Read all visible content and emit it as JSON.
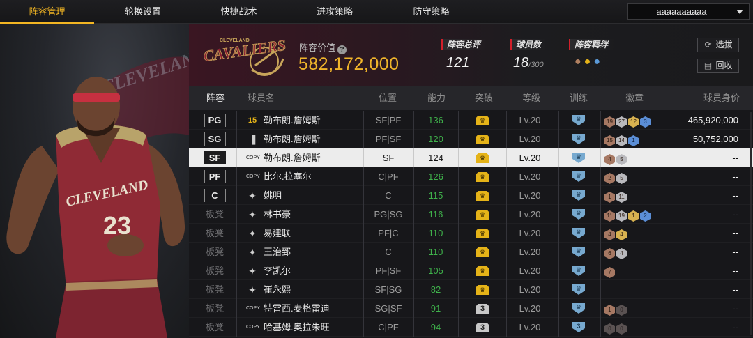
{
  "nav": {
    "tabs": [
      {
        "label": "阵容管理",
        "active": true
      },
      {
        "label": "轮换设置",
        "active": false
      },
      {
        "label": "快捷战术",
        "active": false
      },
      {
        "label": "进攻策略",
        "active": false
      },
      {
        "label": "防守策略",
        "active": false
      }
    ],
    "account_dropdown": "aaaaaaaaaa"
  },
  "team": {
    "logo_text": "CAVALIERS",
    "logo_subtext": "CLEVELAND",
    "value_label": "阵容价值",
    "value": "582,172,000",
    "stats": [
      {
        "label": "阵容总评",
        "value": "121"
      },
      {
        "label": "球员数",
        "value": "18",
        "suffix": "/300"
      },
      {
        "label": "阵容羁绊",
        "value": ""
      }
    ],
    "bond_icons": [
      "bond-icon-bronze",
      "bond-icon-gold",
      "bond-icon-blue"
    ],
    "buttons": {
      "select": "选拔",
      "recycle": "回收"
    }
  },
  "player_art": {
    "jersey_team": "CLEVELAND",
    "jersey_number": "23",
    "bg_text": "CLEVELAND CAVALIERS"
  },
  "table": {
    "headers": {
      "lineup": "阵容",
      "name": "球员名",
      "position": "位置",
      "ability": "能力",
      "breakthrough": "突破",
      "level": "等级",
      "training": "训练",
      "badges": "徽章",
      "value": "球员身价"
    },
    "rows": [
      {
        "slot": "PG",
        "starter": true,
        "card": "15",
        "name": "勒布朗.詹姆斯",
        "pos": "SF|PF",
        "ability": "136",
        "brk": "gold",
        "brk_text": "",
        "level": "Lv.20",
        "train": "",
        "badges": [
          {
            "t": "bronze",
            "v": "19"
          },
          {
            "t": "silver",
            "v": "27"
          },
          {
            "t": "gold",
            "v": "12"
          },
          {
            "t": "blue",
            "v": "3"
          }
        ],
        "value": "465,920,000",
        "selected": false
      },
      {
        "slot": "SG",
        "starter": true,
        "card": "bars",
        "name": "勒布朗.詹姆斯",
        "pos": "PF|SF",
        "ability": "120",
        "brk": "gold",
        "brk_text": "",
        "level": "Lv.20",
        "train": "",
        "badges": [
          {
            "t": "bronze",
            "v": "15"
          },
          {
            "t": "silver",
            "v": "14"
          },
          {
            "t": "blue",
            "v": "1"
          }
        ],
        "value": "50,752,000",
        "selected": false
      },
      {
        "slot": "SF",
        "starter": true,
        "card": "COPY",
        "name": "勒布朗.詹姆斯",
        "pos": "SF",
        "ability": "124",
        "brk": "gold",
        "brk_text": "",
        "level": "Lv.20",
        "train": "",
        "badges": [
          {
            "t": "bronze",
            "v": "4"
          },
          {
            "t": "silver",
            "v": "5"
          }
        ],
        "value": "--",
        "selected": true
      },
      {
        "slot": "PF",
        "starter": true,
        "card": "COPY",
        "name": "比尔.拉塞尔",
        "pos": "C|PF",
        "ability": "126",
        "brk": "gold",
        "brk_text": "",
        "level": "Lv.20",
        "train": "",
        "badges": [
          {
            "t": "bronze",
            "v": "2"
          },
          {
            "t": "silver",
            "v": "5"
          }
        ],
        "value": "--",
        "selected": false
      },
      {
        "slot": "C",
        "starter": true,
        "card": "star",
        "name": "姚明",
        "pos": "C",
        "ability": "115",
        "brk": "gold",
        "brk_text": "",
        "level": "Lv.20",
        "train": "",
        "badges": [
          {
            "t": "bronze",
            "v": "1"
          },
          {
            "t": "silver",
            "v": "11"
          }
        ],
        "value": "--",
        "selected": false
      },
      {
        "slot": "板凳",
        "starter": false,
        "card": "star",
        "name": "林书豪",
        "pos": "PG|SG",
        "ability": "116",
        "brk": "gold",
        "brk_text": "",
        "level": "Lv.20",
        "train": "",
        "badges": [
          {
            "t": "bronze",
            "v": "11"
          },
          {
            "t": "silver",
            "v": "19"
          },
          {
            "t": "gold",
            "v": "1"
          },
          {
            "t": "blue",
            "v": "2"
          }
        ],
        "value": "--",
        "selected": false
      },
      {
        "slot": "板凳",
        "starter": false,
        "card": "star",
        "name": "易建联",
        "pos": "PF|C",
        "ability": "110",
        "brk": "gold",
        "brk_text": "",
        "level": "Lv.20",
        "train": "",
        "badges": [
          {
            "t": "bronze",
            "v": "4"
          },
          {
            "t": "gold",
            "v": "4"
          }
        ],
        "value": "--",
        "selected": false
      },
      {
        "slot": "板凳",
        "starter": false,
        "card": "star",
        "name": "王治郅",
        "pos": "C",
        "ability": "110",
        "brk": "gold",
        "brk_text": "",
        "level": "Lv.20",
        "train": "",
        "badges": [
          {
            "t": "bronze",
            "v": "6"
          },
          {
            "t": "silver",
            "v": "4"
          }
        ],
        "value": "--",
        "selected": false
      },
      {
        "slot": "板凳",
        "starter": false,
        "card": "star",
        "name": "李凯尔",
        "pos": "PF|SF",
        "ability": "105",
        "brk": "gold",
        "brk_text": "",
        "level": "Lv.20",
        "train": "",
        "badges": [
          {
            "t": "bronze",
            "v": "7"
          }
        ],
        "value": "--",
        "selected": false
      },
      {
        "slot": "板凳",
        "starter": false,
        "card": "star",
        "name": "崔永熙",
        "pos": "SF|SG",
        "ability": "82",
        "brk": "gold",
        "brk_text": "",
        "level": "Lv.20",
        "train": "",
        "badges": [],
        "value": "--",
        "selected": false
      },
      {
        "slot": "板凳",
        "starter": false,
        "card": "COPY",
        "name": "特雷西.麦格雷迪",
        "pos": "SG|SF",
        "ability": "91",
        "brk": "gray",
        "brk_text": "3",
        "level": "Lv.20",
        "train": "",
        "badges": [
          {
            "t": "bronze",
            "v": "1"
          },
          {
            "t": "dark",
            "v": "0"
          }
        ],
        "value": "--",
        "selected": false
      },
      {
        "slot": "板凳",
        "starter": false,
        "card": "COPY",
        "name": "哈基姆.奥拉朱旺",
        "pos": "C|PF",
        "ability": "94",
        "brk": "gray",
        "brk_text": "3",
        "level": "Lv.20",
        "train": "3",
        "badges": [
          {
            "t": "dark",
            "v": "0"
          },
          {
            "t": "dark",
            "v": "0"
          }
        ],
        "value": "--",
        "selected": false
      }
    ]
  },
  "colors": {
    "accent": "#f3b623",
    "ability_green": "#3fb24b",
    "team_wine": "#3a1622"
  }
}
